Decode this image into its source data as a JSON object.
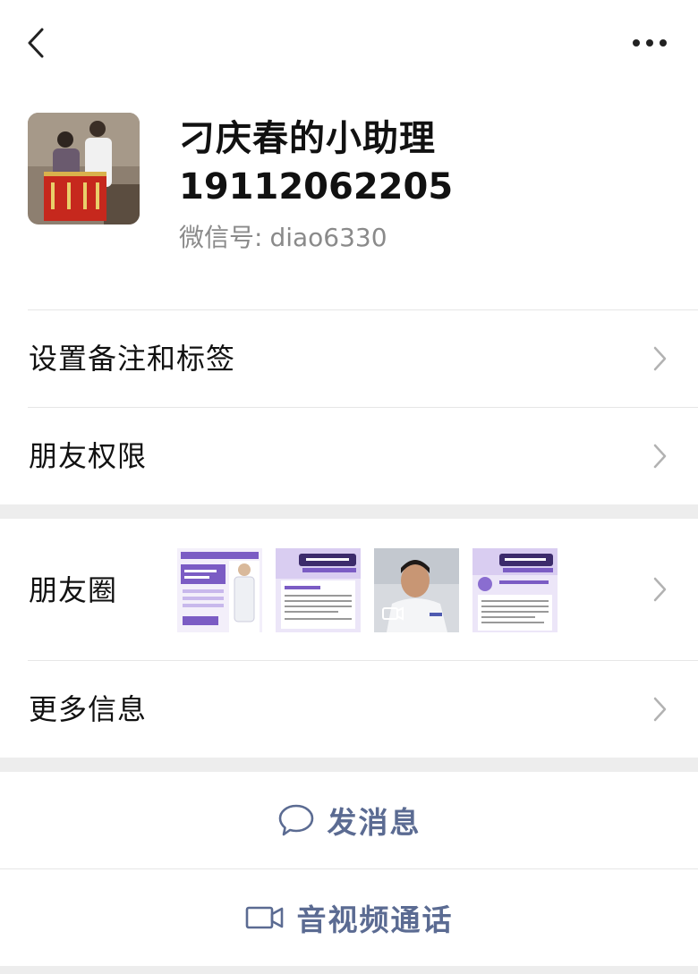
{
  "topbar": {
    "back_icon": "chevron-left-icon",
    "more_icon": "more-horizontal-icon"
  },
  "profile": {
    "name": "刁庆春的小助理",
    "phone": "19112062205",
    "wechat_id_label": "微信号:",
    "wechat_id": "diao6330"
  },
  "rows": {
    "remark": "设置备注和标签",
    "permission": "朋友权限",
    "moments": "朋友圈",
    "more_info": "更多信息"
  },
  "moments_thumbs": [
    {
      "kind": "poster",
      "accent": "#7b5cc4"
    },
    {
      "kind": "poster",
      "accent": "#7b5cc4",
      "title": "暑期祛痘季"
    },
    {
      "kind": "video"
    },
    {
      "kind": "poster",
      "accent": "#7b5cc4",
      "title": "暑期祛痘季"
    }
  ],
  "actions": {
    "message": "发消息",
    "call": "音视频通话"
  },
  "colors": {
    "action_blue": "#5b6b92",
    "separator": "#ededed",
    "secondary_text": "#8a8a8a"
  }
}
